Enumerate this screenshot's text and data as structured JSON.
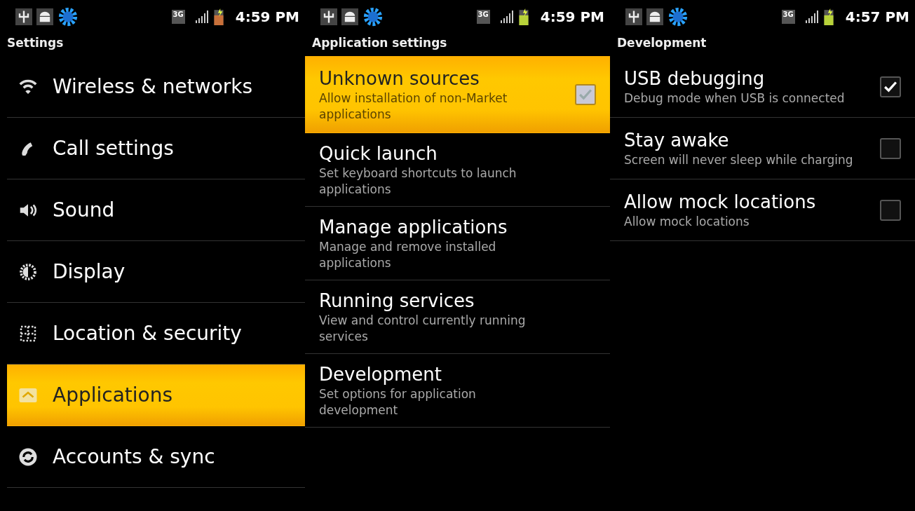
{
  "screens": [
    {
      "kind": "menu",
      "status_bar": {
        "network": "3G",
        "time": "4:59 PM"
      },
      "title": "Settings",
      "items": [
        {
          "label": "Wireless & networks",
          "kind": "wifi",
          "selected": false
        },
        {
          "label": "Call settings",
          "kind": "phone",
          "selected": false
        },
        {
          "label": "Sound",
          "kind": "speaker",
          "selected": false
        },
        {
          "label": "Display",
          "kind": "brightness",
          "selected": false
        },
        {
          "label": "Location & security",
          "kind": "grid",
          "selected": false
        },
        {
          "label": "Applications",
          "kind": "apps",
          "selected": true
        },
        {
          "label": "Accounts & sync",
          "kind": "sync",
          "selected": false
        }
      ]
    },
    {
      "kind": "prefs",
      "status_bar": {
        "network": "3G",
        "time": "4:59 PM"
      },
      "title": "Application settings",
      "items": [
        {
          "kind": "checkbox",
          "title": "Unknown sources",
          "summary": "Allow installation of non-Market applications",
          "checked": true,
          "selected": true
        },
        {
          "kind": "link",
          "title": "Quick launch",
          "summary": "Set keyboard shortcuts to launch applications",
          "selected": false
        },
        {
          "kind": "link",
          "title": "Manage applications",
          "summary": "Manage and remove installed applications",
          "selected": false
        },
        {
          "kind": "link",
          "title": "Running services",
          "summary": "View and control currently running services",
          "selected": false
        },
        {
          "kind": "link",
          "title": "Development",
          "summary": "Set options for application development",
          "selected": false
        }
      ]
    },
    {
      "kind": "prefs",
      "status_bar": {
        "network": "3G",
        "time": "4:57 PM"
      },
      "title": "Development",
      "items": [
        {
          "kind": "checkbox",
          "title": "USB debugging",
          "summary": "Debug mode when USB is connected",
          "checked": true,
          "selected": false
        },
        {
          "kind": "checkbox",
          "title": "Stay awake",
          "summary": "Screen will never sleep while charging",
          "checked": false,
          "selected": false
        },
        {
          "kind": "checkbox",
          "title": "Allow mock locations",
          "summary": "Allow mock locations",
          "checked": false,
          "selected": false
        }
      ]
    }
  ]
}
